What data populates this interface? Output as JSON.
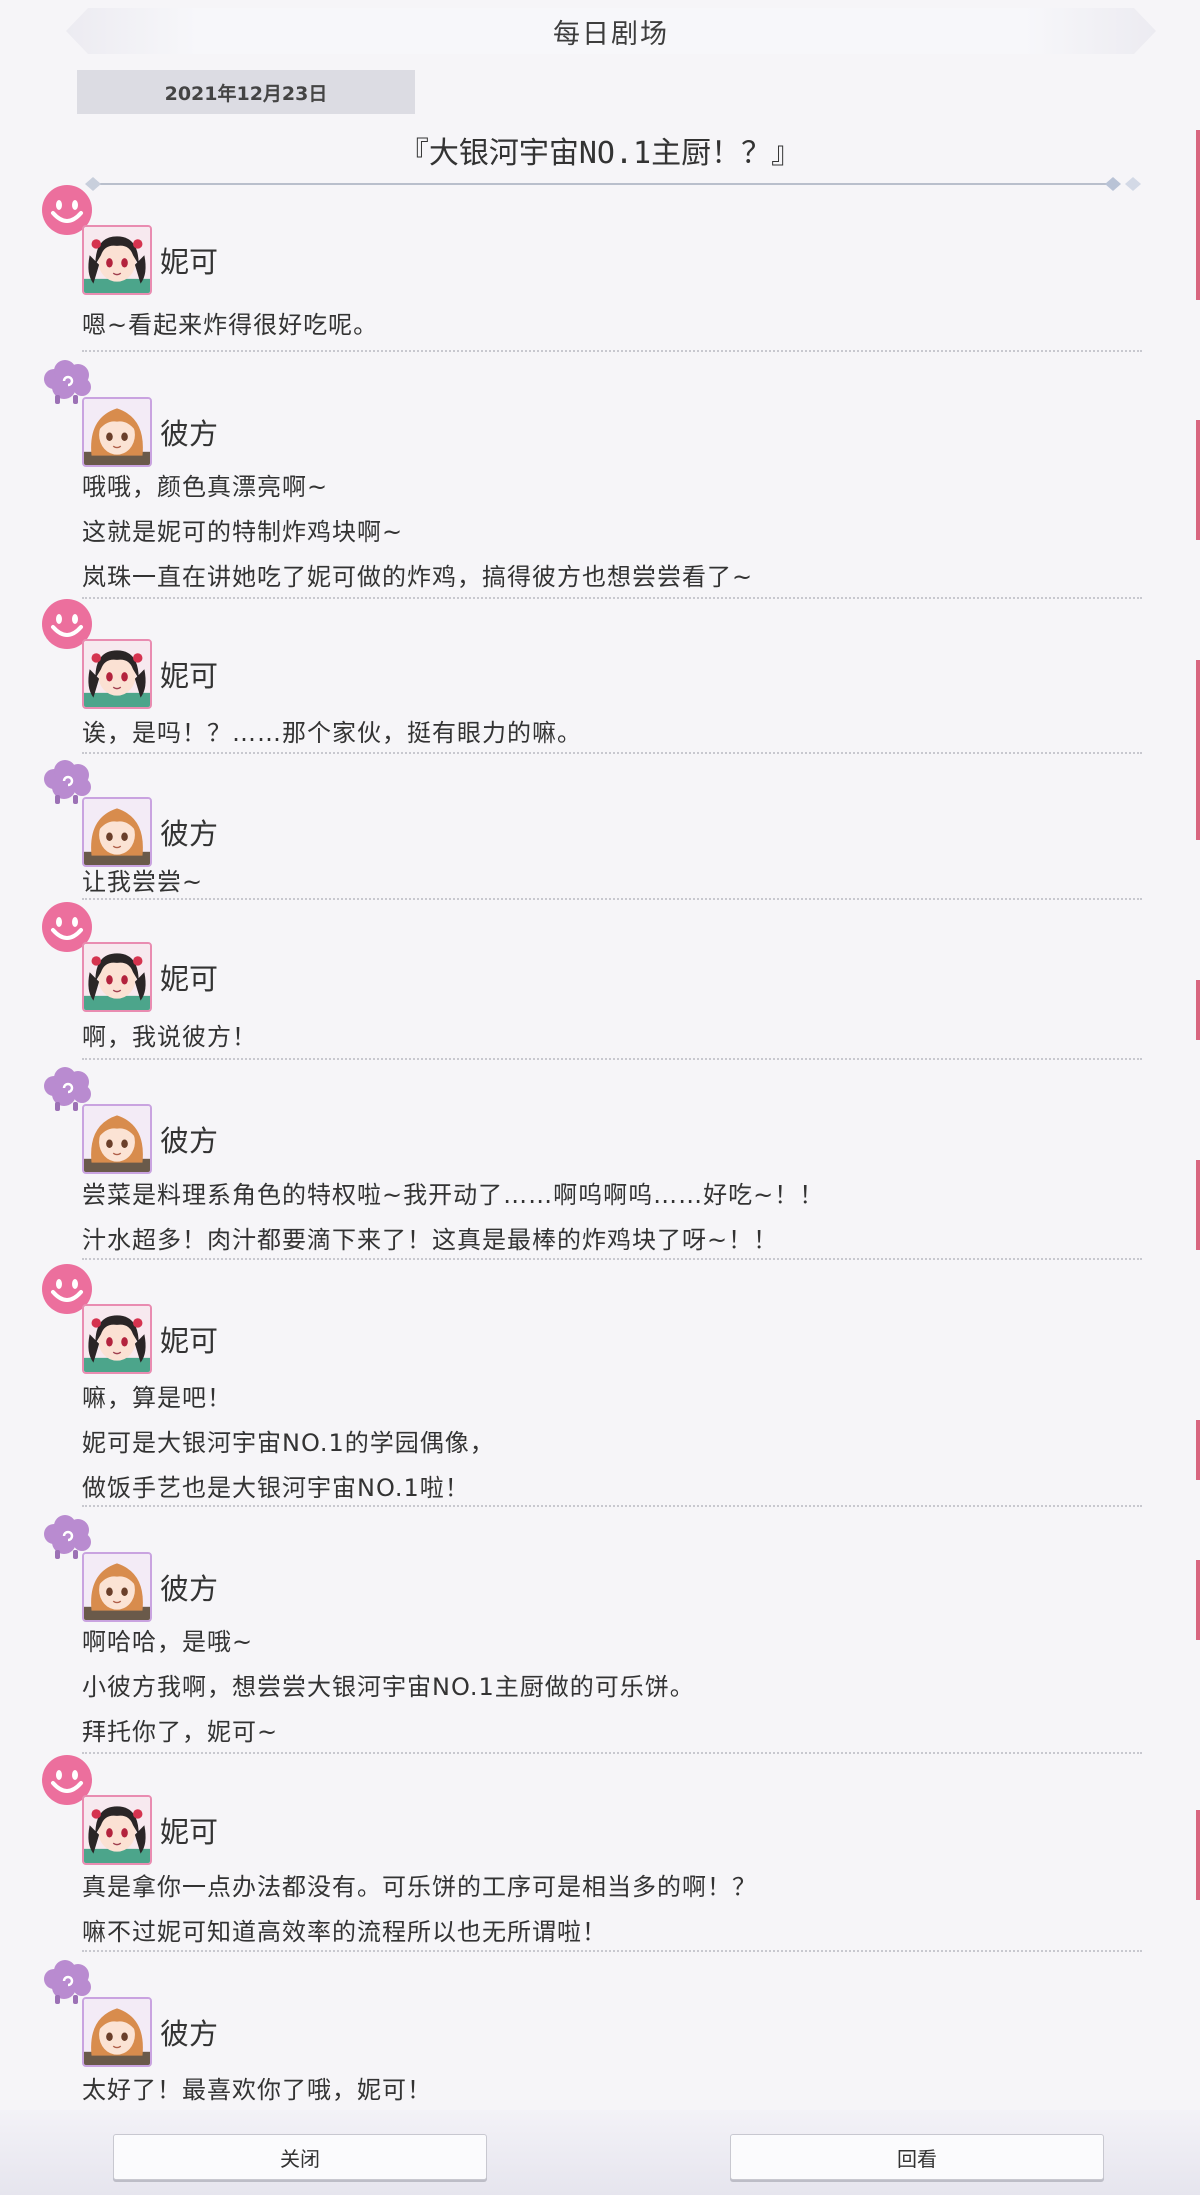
{
  "header": {
    "title": "每日剧场",
    "date": "2021年12月23日",
    "story_title": "『大银河宇宙NO.1主厨！？』"
  },
  "characters": {
    "nico": {
      "name": "妮可",
      "emote_icon": "pink-smiley-icon",
      "accent": "#ea6b9a"
    },
    "kanata": {
      "name": "彼方",
      "emote_icon": "purple-sheep-icon",
      "accent": "#b78bd0"
    }
  },
  "messages": [
    {
      "speaker": "nico",
      "speaker_name": "妮可",
      "lines": [
        "嗯~看起来炸得很好吃呢。"
      ]
    },
    {
      "speaker": "kanata",
      "speaker_name": "彼方",
      "lines": [
        "哦哦，颜色真漂亮啊~",
        "这就是妮可的特制炸鸡块啊~",
        "岚珠一直在讲她吃了妮可做的炸鸡，搞得彼方也想尝尝看了~"
      ]
    },
    {
      "speaker": "nico",
      "speaker_name": "妮可",
      "lines": [
        "诶，是吗！？……那个家伙，挺有眼力的嘛。"
      ]
    },
    {
      "speaker": "kanata",
      "speaker_name": "彼方",
      "lines": [
        "让我尝尝~"
      ]
    },
    {
      "speaker": "nico",
      "speaker_name": "妮可",
      "lines": [
        "啊，我说彼方！"
      ]
    },
    {
      "speaker": "kanata",
      "speaker_name": "彼方",
      "lines": [
        "尝菜是料理系角色的特权啦~我开动了……啊呜啊呜……好吃~！！",
        "汁水超多！肉汁都要滴下来了！这真是最棒的炸鸡块了呀~！！"
      ]
    },
    {
      "speaker": "nico",
      "speaker_name": "妮可",
      "lines": [
        "嘛，算是吧！",
        "妮可是大银河宇宙NO.1的学园偶像，",
        "做饭手艺也是大银河宇宙NO.1啦！"
      ]
    },
    {
      "speaker": "kanata",
      "speaker_name": "彼方",
      "lines": [
        "啊哈哈，是哦~",
        "小彼方我啊，想尝尝大银河宇宙NO.1主厨做的可乐饼。",
        "拜托你了，妮可~"
      ]
    },
    {
      "speaker": "nico",
      "speaker_name": "妮可",
      "lines": [
        "真是拿你一点办法都没有。可乐饼的工序可是相当多的啊！？",
        "嘛不过妮可知道高效率的流程所以也无所谓啦！"
      ]
    },
    {
      "speaker": "kanata",
      "speaker_name": "彼方",
      "lines": [
        "太好了！最喜欢你了哦，妮可！"
      ]
    }
  ],
  "footer": {
    "close_label": "关闭",
    "replay_label": "回看"
  }
}
